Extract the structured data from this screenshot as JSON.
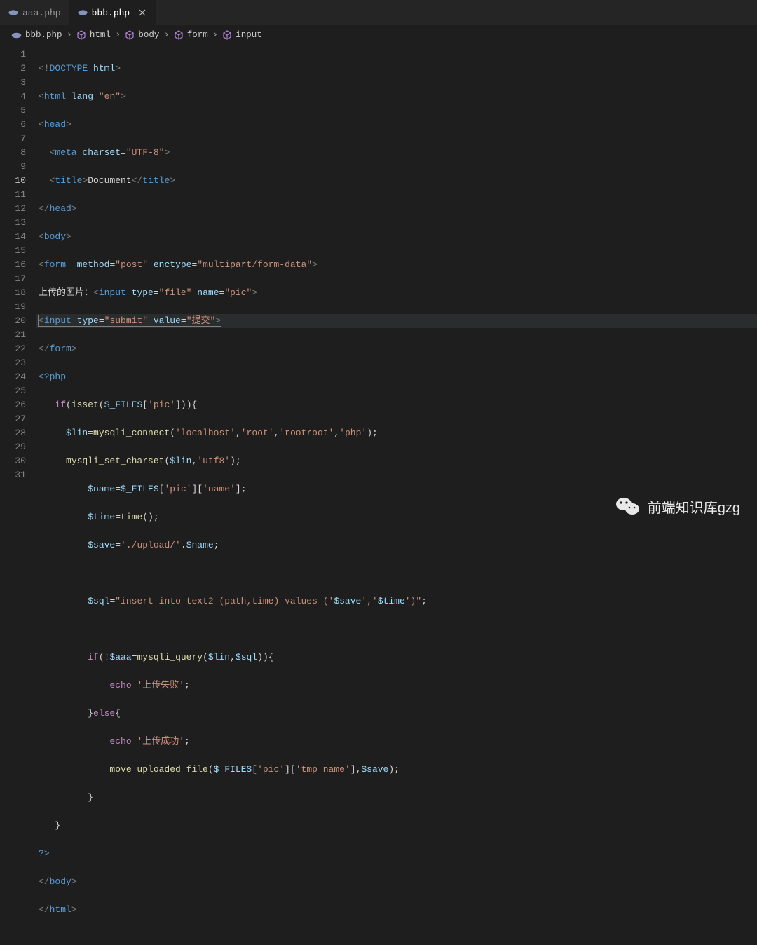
{
  "tabs": [
    {
      "name": "aaa.php",
      "active": false
    },
    {
      "name": "bbb.php",
      "active": true
    }
  ],
  "breadcrumb": {
    "items": [
      {
        "icon": "php",
        "label": "bbb.php"
      },
      {
        "icon": "cube",
        "label": "html"
      },
      {
        "icon": "cube",
        "label": "body"
      },
      {
        "icon": "cube",
        "label": "form"
      },
      {
        "icon": "cube",
        "label": "input"
      }
    ]
  },
  "currentLine": 10,
  "lineCount": 31,
  "code": {
    "l1": {
      "a": "<!",
      "b": "DOCTYPE",
      "c": " html",
      "d": ">"
    },
    "l2": {
      "a": "<",
      "b": "html",
      "c": " lang",
      "d": "=",
      "e": "\"en\"",
      "f": ">"
    },
    "l3": {
      "a": "<",
      "b": "head",
      "c": ">"
    },
    "l4": {
      "a": "  <",
      "b": "meta",
      "c": " charset",
      "d": "=",
      "e": "\"UTF-8\"",
      "f": ">"
    },
    "l5": {
      "a": "  <",
      "b": "title",
      "c": ">",
      "d": "Document",
      "e": "</",
      "f": "title",
      "g": ">"
    },
    "l6": {
      "a": "</",
      "b": "head",
      "c": ">"
    },
    "l7": {
      "a": "<",
      "b": "body",
      "c": ">"
    },
    "l8": {
      "a": "<",
      "b": "form",
      "c": "  method",
      "d": "=",
      "e": "\"post\"",
      "f": " enctype",
      "g": "=",
      "h": "\"multipart/form-data\"",
      "i": ">"
    },
    "l9": {
      "a": "上传的图片：",
      "b": "<",
      "c": "input",
      "d": " type",
      "e": "=",
      "f": "\"file\"",
      "g": " name",
      "h": "=",
      "i": "\"pic\"",
      "j": ">"
    },
    "l10": {
      "a": "<",
      "b": "input",
      "c": " type",
      "d": "=",
      "e": "\"submit\"",
      "f": " value",
      "g": "=",
      "h": "\"提交\"",
      "i": ">"
    },
    "l11": {
      "a": "</",
      "b": "form",
      "c": ">"
    },
    "l12": {
      "a": "<?php"
    },
    "l13": {
      "a": "   if",
      "b": "(",
      "c": "isset",
      "d": "(",
      "e": "$_FILES",
      "f": "[",
      "g": "'pic'",
      "h": "])){"
    },
    "l14": {
      "a": "     ",
      "b": "$lin",
      "c": "=",
      "d": "mysqli_connect",
      "e": "(",
      "f": "'localhost'",
      "g": ",",
      "h": "'root'",
      "i": ",",
      "j": "'rootroot'",
      "k": ",",
      "l": "'php'",
      "m": ");"
    },
    "l15": {
      "a": "     ",
      "b": "mysqli_set_charset",
      "c": "(",
      "d": "$lin",
      "e": ",",
      "f": "'utf8'",
      "g": ");"
    },
    "l16": {
      "a": "         ",
      "b": "$name",
      "c": "=",
      "d": "$_FILES",
      "e": "[",
      "f": "'pic'",
      "g": "][",
      "h": "'name'",
      "i": "];"
    },
    "l17": {
      "a": "         ",
      "b": "$time",
      "c": "=",
      "d": "time",
      "e": "();"
    },
    "l18": {
      "a": "         ",
      "b": "$save",
      "c": "=",
      "d": "'./upload/'",
      "e": ".",
      "f": "$name",
      "g": ";"
    },
    "l20": {
      "a": "         ",
      "b": "$sql",
      "c": "=",
      "d": "\"insert into text2 (path,time) values ('",
      "e": "$save",
      "f": "','",
      "g": "$time",
      "h": "')\"",
      "i": ";"
    },
    "l22": {
      "a": "         if",
      "b": "(!",
      "c": "$aaa",
      "d": "=",
      "e": "mysqli_query",
      "f": "(",
      "g": "$lin",
      "h": ",",
      "i": "$sql",
      "j": ")){"
    },
    "l23": {
      "a": "             echo ",
      "b": "'上传失败'",
      "c": ";"
    },
    "l24": {
      "a": "         }",
      "b": "else",
      "c": "{"
    },
    "l25": {
      "a": "             echo ",
      "b": "'上传成功'",
      "c": ";"
    },
    "l26": {
      "a": "             ",
      "b": "move_uploaded_file",
      "c": "(",
      "d": "$_FILES",
      "e": "[",
      "f": "'pic'",
      "g": "][",
      "h": "'tmp_name'",
      "i": "],",
      "j": "$save",
      "k": ");"
    },
    "l27": {
      "a": "         }"
    },
    "l28": {
      "a": "   }"
    },
    "l29": {
      "a": "?>"
    },
    "l30": {
      "a": "</",
      "b": "body",
      "c": ">"
    },
    "l31": {
      "a": "</",
      "b": "html",
      "c": ">"
    }
  },
  "watermark": "前端知识库gzg"
}
